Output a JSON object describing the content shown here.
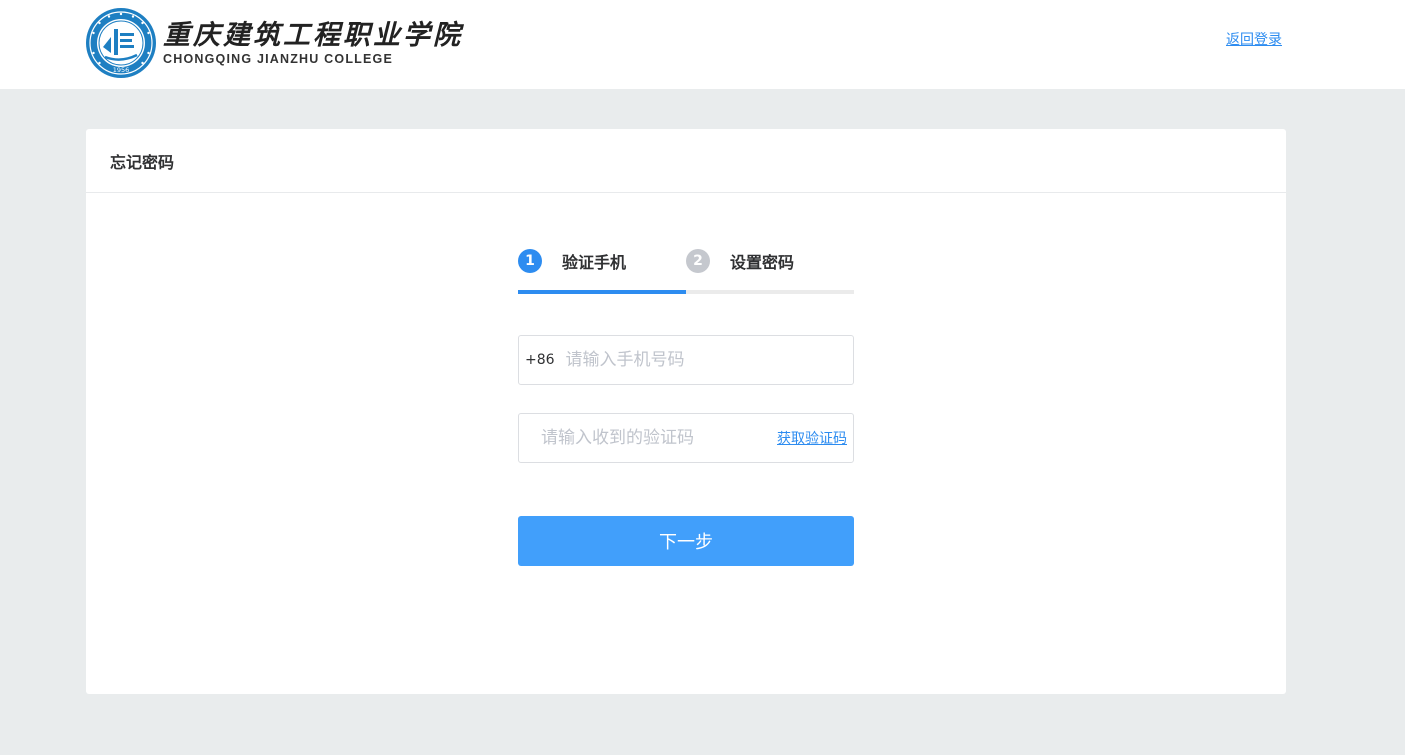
{
  "header": {
    "logo": {
      "name_cn": "重庆建筑工程职业学院",
      "name_en": "CHONGQING JIANZHU COLLEGE",
      "seal_year": "1956",
      "seal_icon": "college-seal-icon"
    },
    "back_link": "返回登录"
  },
  "card": {
    "title": "忘记密码"
  },
  "steps": [
    {
      "number": "1",
      "label": "验证手机",
      "active": true
    },
    {
      "number": "2",
      "label": "设置密码",
      "active": false
    }
  ],
  "progress": {
    "fraction": 0.5
  },
  "form": {
    "phone": {
      "prefix": "+86",
      "placeholder": "请输入手机号码",
      "value": ""
    },
    "code": {
      "placeholder": "请输入收到的验证码",
      "value": "",
      "get_code_label": "获取验证码"
    },
    "next_label": "下一步"
  },
  "colors": {
    "primary": "#2d8cf0",
    "button": "#419ffb",
    "page_background": "#e9eced",
    "step_inactive": "#c5c8ce"
  }
}
